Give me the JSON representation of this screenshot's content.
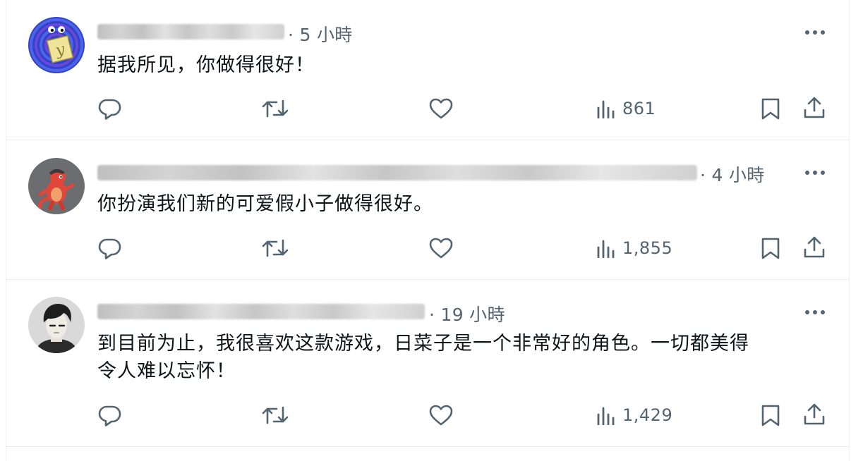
{
  "replies": [
    {
      "timestamp": "· 5 小時",
      "text": [
        "据我所见，你做得很好！"
      ],
      "views": "861",
      "avatar_icon": "sticky-note-avatar-icon"
    },
    {
      "timestamp": "· 4 小時",
      "text": [
        "你扮演我们新的可爱假小子做得很好。"
      ],
      "views": "1,855",
      "avatar_icon": "red-dinosaur-avatar-icon"
    },
    {
      "timestamp": "· 19 小時",
      "text": [
        "到目前为止，我很喜欢这款游戏，日菜子是一个非常好的角色。一切都美得",
        "令人难以忘怀！"
      ],
      "views": "1,429",
      "avatar_icon": "anime-portrait-avatar-icon"
    }
  ],
  "colors": {
    "text": "#0f1419",
    "muted": "#536471",
    "divider": "#e6ecf0"
  },
  "icons": [
    "reply-icon",
    "repost-icon",
    "like-icon",
    "views-icon",
    "bookmark-icon",
    "share-icon",
    "more-icon"
  ]
}
